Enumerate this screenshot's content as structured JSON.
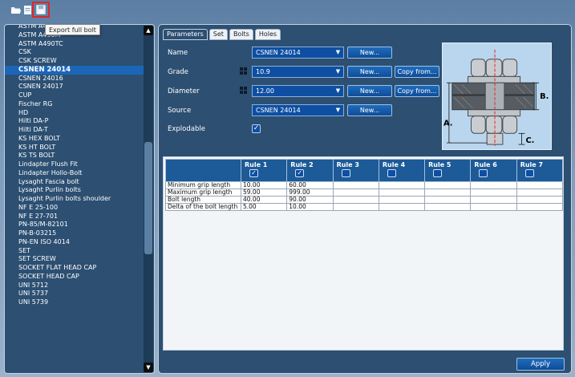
{
  "toolbar": {
    "tooltip": "Export full bolt",
    "icons": [
      "folder-open-icon",
      "new-document-icon",
      "export-disk-icon"
    ],
    "highlight_color": "#e0262a"
  },
  "bolt_list": {
    "items": [
      "ASTM A490",
      "ASTM A490M",
      "ASTM A490TC",
      "CSK",
      "CSK SCREW",
      "CSNEN 24014",
      "CSNEN 24016",
      "CSNEN 24017",
      "CUP",
      "Fischer RG",
      "HD",
      "Hilti DA-P",
      "Hilti DA-T",
      "KS HEX BOLT",
      "KS HT BOLT",
      "KS TS BOLT",
      "Lindapter Flush Fit",
      "Lindapter Hollo-Bolt",
      "Lysaght Fascia bolt",
      "Lysaght Purlin bolts",
      "Lysaght Purlin bolts shoulder",
      "NF E 25-100",
      "NF E 27-701",
      "PN-85/M-82101",
      "PN-B-03215",
      "PN-EN ISO 4014",
      "SET",
      "SET SCREW",
      "SOCKET FLAT HEAD CAP",
      "SOCKET HEAD CAP",
      "UNI 5712",
      "UNI 5737",
      "UNI 5739"
    ],
    "selected": "CSNEN 24014",
    "selected_color": "#1c66b8"
  },
  "tabs": [
    "Parameters",
    "Set",
    "Bolts",
    "Holes"
  ],
  "active_tab": "Parameters",
  "form": {
    "name_label": "Name",
    "name_value": "CSNEN 24014",
    "grade_label": "Grade",
    "grade_value": "10.9",
    "diameter_label": "Diameter",
    "diameter_value": "12.00",
    "source_label": "Source",
    "source_value": "CSNEN 24014",
    "explodable_label": "Explodable",
    "explodable_checked": true,
    "new_label": "New...",
    "copy_label": "Copy from..."
  },
  "diagram": {
    "label_a": "A.",
    "label_b": "B.",
    "label_c": "C."
  },
  "rules": {
    "columns": [
      {
        "label": "Rule 1",
        "checked": true
      },
      {
        "label": "Rule 2",
        "checked": true
      },
      {
        "label": "Rule 3",
        "checked": false
      },
      {
        "label": "Rule 4",
        "checked": false
      },
      {
        "label": "Rule 5",
        "checked": false
      },
      {
        "label": "Rule 6",
        "checked": false
      },
      {
        "label": "Rule 7",
        "checked": false
      }
    ],
    "rows": [
      {
        "label": "Minimum grip length",
        "values": [
          "10.00",
          "60.00",
          "",
          "",
          "",
          "",
          ""
        ]
      },
      {
        "label": "Maximum grip length",
        "values": [
          "59.00",
          "999.00",
          "",
          "",
          "",
          "",
          ""
        ]
      },
      {
        "label": "Bolt length",
        "values": [
          "40.00",
          "90.00",
          "",
          "",
          "",
          "",
          ""
        ]
      },
      {
        "label": "Delta of the bolt length",
        "values": [
          "5.00",
          "10.00",
          "",
          "",
          "",
          "",
          ""
        ]
      }
    ]
  },
  "apply_label": "Apply"
}
